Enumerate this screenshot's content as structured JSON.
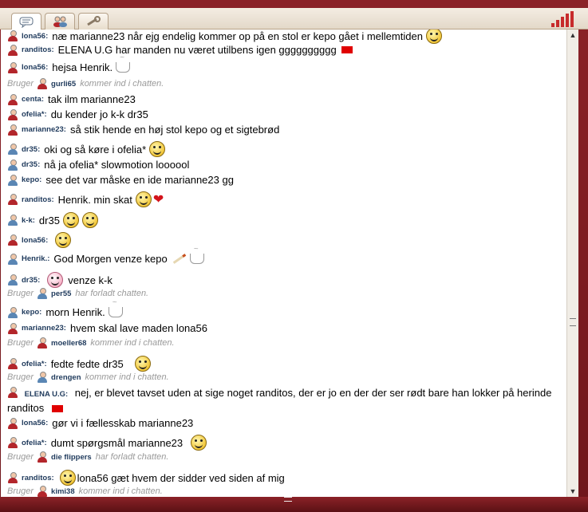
{
  "tabs": [
    {
      "name": "chat",
      "icon": "speech-bubble-icon"
    },
    {
      "name": "users",
      "icon": "users-icon"
    },
    {
      "name": "tools",
      "icon": "wrench-icon"
    }
  ],
  "colors": {
    "frame": "#7a1d22",
    "female": "#b3262b",
    "male": "#5a86b4",
    "nick": "#1f3a5c",
    "system": "#9a9a9a"
  },
  "messages": [
    {
      "gender": "f",
      "nick": "lona56:",
      "text": "næ marianne23 når ejg endelig kommer op på en stol er kepo gået i mellemtiden"
    },
    {
      "gender": "f",
      "nick": "randitos:",
      "text": "ELENA U.G  har  manden  nu  været  utilbens  igen  gggggggggg"
    },
    {
      "gender": "f",
      "nick": "lona56:",
      "text": "hejsa Henrik."
    },
    {
      "system": true,
      "prefix": "Bruger",
      "gender": "f",
      "nick": "gurli65",
      "text": "kommer ind i chatten."
    },
    {
      "gender": "f",
      "nick": "centa:",
      "text": "tak ilm marianne23"
    },
    {
      "gender": "f",
      "nick": "ofelia*:",
      "text": "du kender jo k-k dr35"
    },
    {
      "gender": "f",
      "nick": "marianne23:",
      "text": "så stik hende en høj stol kepo og et sigtebrød"
    },
    {
      "gender": "m",
      "nick": "dr35:",
      "text": "oki og så køre i ofelia*"
    },
    {
      "gender": "m",
      "nick": "dr35:",
      "text": "nå ja ofelia* slowmotion loooool"
    },
    {
      "gender": "m",
      "nick": "kepo:",
      "text": "see det var måske en ide marianne23 gg"
    },
    {
      "gender": "f",
      "nick": "randitos:",
      "text": "Henrik.  min  skat"
    },
    {
      "gender": "m",
      "nick": "k-k:",
      "text": "dr35"
    },
    {
      "gender": "f",
      "nick": "lona56:",
      "text": ""
    },
    {
      "gender": "m",
      "nick": "Henrik.:",
      "text": "God Morgen venze kepo"
    },
    {
      "gender": "m",
      "nick": "dr35:",
      "text": "venze k-k"
    },
    {
      "system": true,
      "prefix": "Bruger",
      "gender": "m",
      "nick": "per55",
      "text": "har forladt chatten."
    },
    {
      "gender": "m",
      "nick": "kepo:",
      "text": "morn Henrik."
    },
    {
      "gender": "f",
      "nick": "marianne23:",
      "text": "hvem skal lave maden lona56"
    },
    {
      "system": true,
      "prefix": "Bruger",
      "gender": "f",
      "nick": "moeller68",
      "text": "kommer ind i chatten."
    },
    {
      "gender": "f",
      "nick": "ofelia*:",
      "text": "fedte fedte dr35"
    },
    {
      "system": true,
      "prefix": "Bruger",
      "gender": "m",
      "nick": "drengen",
      "text": "kommer ind i chatten."
    },
    {
      "gender": "f",
      "nick": "ELENA U.G:",
      "text": "nej, er blevet tavset uden at sige noget randitos, der er jo en der der ser rødt bare han lokker på herinde  randitos"
    },
    {
      "gender": "f",
      "nick": "lona56:",
      "text": "gør vi i fællesskab marianne23"
    },
    {
      "gender": "f",
      "nick": "ofelia*:",
      "text": "dumt spørgsmål marianne23"
    },
    {
      "system": true,
      "prefix": "Bruger",
      "gender": "m",
      "nick": "die flippers",
      "text": "har forladt chatten."
    },
    {
      "gender": "f",
      "nick": "randitos:",
      "text": "lona56  gæt  hvem  der  sidder  ved  siden  af  mig"
    },
    {
      "system": true,
      "prefix": "Bruger",
      "gender": "f",
      "nick": "kimi38",
      "text": "kommer ind i chatten."
    }
  ]
}
